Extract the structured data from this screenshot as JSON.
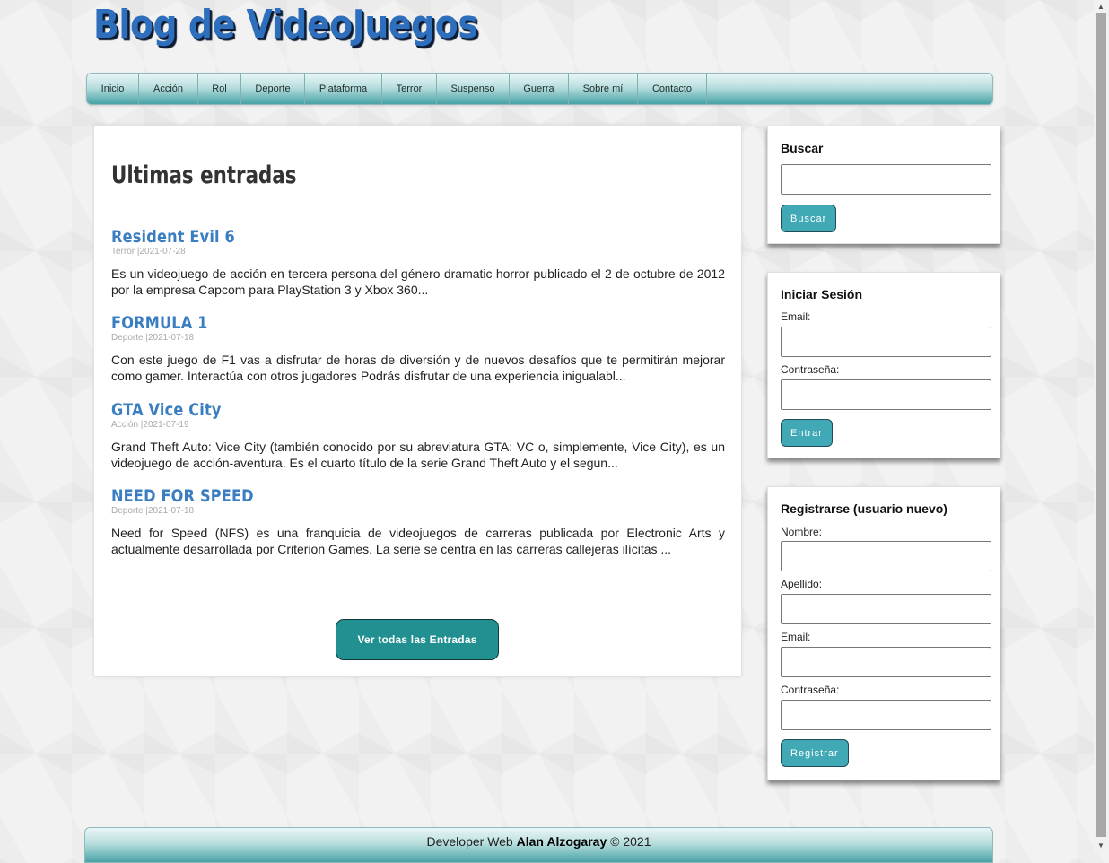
{
  "site": {
    "title": "Blog de VideoJuegos"
  },
  "nav": {
    "items": [
      "Inicio",
      "Acción",
      "Rol",
      "Deporte",
      "Plataforma",
      "Terror",
      "Suspenso",
      "Guerra",
      "Sobre mí",
      "Contacto"
    ]
  },
  "main": {
    "heading": "Ultimas entradas",
    "posts": [
      {
        "title": "Resident Evil 6",
        "meta": "Terror |2021-07-28",
        "excerpt": "Es un videojuego de acción en tercera persona del género dramatic horror publicado el 2 de octubre de 2012 por la empresa Capcom para PlayStation 3 y Xbox 360..."
      },
      {
        "title": "FORMULA 1",
        "meta": "Deporte |2021-07-18",
        "excerpt": "Con este juego de F1 vas a disfrutar de horas de diversión y de nuevos desafíos que te permitirán mejorar como gamer. Interactúa con otros jugadores Podrás disfrutar de una experiencia inigualabl..."
      },
      {
        "title": "GTA Vice City",
        "meta": "Acción |2021-07-19",
        "excerpt": "Grand Theft Auto: Vice City (también conocido por su abreviatura GTA: VC o, simplemente, Vice City), es un videojuego de acción-aventura. Es el cuarto título de la serie Grand Theft Auto y el segun..."
      },
      {
        "title": "NEED FOR SPEED",
        "meta": "Deporte |2021-07-18",
        "excerpt": "Need for Speed (NFS) es una franquicia de videojuegos de carreras publicada por Electronic Arts y actualmente desarrollada por Criterion Games. La serie se centra en las carreras callejeras ilícitas ..."
      }
    ],
    "view_all_label": "Ver todas las Entradas"
  },
  "sidebar": {
    "search": {
      "title": "Buscar",
      "button": "Buscar"
    },
    "login": {
      "title": "Iniciar Sesión",
      "email_label": "Email:",
      "password_label": "Contraseña:",
      "button": "Entrar"
    },
    "register": {
      "title": "Registrarse (usuario nuevo)",
      "name_label": "Nombre:",
      "lastname_label": "Apellido:",
      "email_label": "Email:",
      "password_label": "Contraseña:",
      "button": "Registrar"
    }
  },
  "footer": {
    "prefix": "Developer Web",
    "author": "Alan Alzogaray",
    "suffix": "© 2021"
  },
  "colors": {
    "title_blue": "#2e6fbd",
    "post_title_blue": "#3a7ec1",
    "teal_button": "#229090",
    "side_button": "#41a9b6"
  }
}
